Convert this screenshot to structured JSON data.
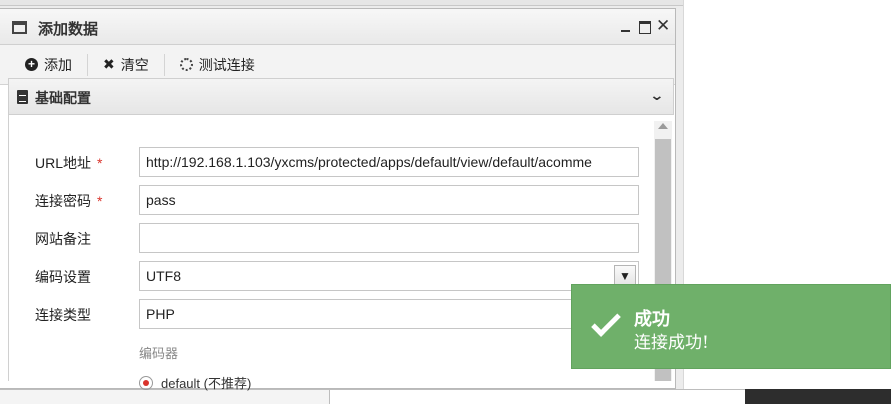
{
  "dialog": {
    "title": "添加数据",
    "close_glyph": "✕"
  },
  "toolbar": {
    "add_label": "添加",
    "clear_label": "清空",
    "test_label": "测试连接"
  },
  "section": {
    "title": "基础配置"
  },
  "form": {
    "url_label": "URL地址",
    "url_value": "http://192.168.1.103/yxcms/protected/apps/default/view/default/acomme",
    "password_label": "连接密码",
    "password_value": "pass",
    "note_label": "网站备注",
    "note_value": "",
    "encoding_label": "编码设置",
    "encoding_value": "UTF8",
    "type_label": "连接类型",
    "type_value": "PHP",
    "required_mark": "*",
    "encoder_label": "编码器",
    "encoder_option": "default (不推荐)"
  },
  "toast": {
    "title": "成功",
    "message": "连接成功!"
  },
  "colors": {
    "toast_bg": "#6fb06a",
    "required": "#d9332b"
  }
}
